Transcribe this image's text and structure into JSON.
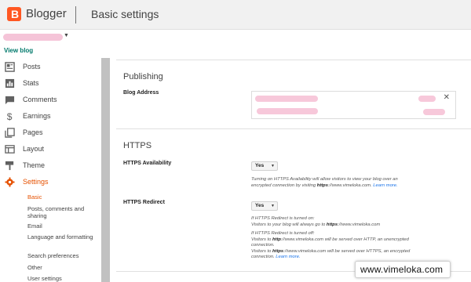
{
  "header": {
    "brand": "Blogger",
    "page_title": "Basic settings",
    "logo_letter": "B",
    "logo_color": "#ff5722"
  },
  "blog_picker": {
    "view_blog": "View blog"
  },
  "sidebar": {
    "items": [
      {
        "label": "Posts",
        "icon": "posts-icon"
      },
      {
        "label": "Stats",
        "icon": "stats-icon"
      },
      {
        "label": "Comments",
        "icon": "comments-icon"
      },
      {
        "label": "Earnings",
        "icon": "dollar-icon"
      },
      {
        "label": "Pages",
        "icon": "pages-icon"
      },
      {
        "label": "Layout",
        "icon": "layout-icon"
      },
      {
        "label": "Theme",
        "icon": "theme-icon"
      },
      {
        "label": "Settings",
        "icon": "gear-icon"
      }
    ],
    "settings_sub": [
      "Basic",
      "Posts, comments and sharing",
      "Email",
      "Language and formatting",
      "Search preferences",
      "Other",
      "User settings"
    ]
  },
  "main": {
    "publishing": {
      "title": "Publishing",
      "blog_address_label": "Blog Address"
    },
    "https": {
      "title": "HTTPS",
      "availability_label": "HTTPS Availability",
      "availability_value": "Yes",
      "availability_help_1": "Turning on HTTPS Availability will allow visitors to view your blog over an",
      "availability_help_2a": "encrypted connection by visiting ",
      "availability_help_2b": "https",
      "availability_help_2c": "://www.vimeloka.com. ",
      "learn_more": "Learn more.",
      "redirect_label": "HTTPS Redirect",
      "redirect_value": "Yes",
      "redirect_help_1": "If HTTPS Redirect is turned on:",
      "redirect_help_2a": "Visitors to your blog will always go to ",
      "redirect_help_2b": "https",
      "redirect_help_2c": "://www.vimeloka.com",
      "redirect_help_3": "If HTTPS Redirect is turned off:",
      "redirect_help_4a": "Visitors to ",
      "redirect_help_4b": "http",
      "redirect_help_4c": "://www.vimeloka.com will be served over HTTP, an unencrypted",
      "redirect_help_5": "connection.",
      "redirect_help_6a": "Visitors to ",
      "redirect_help_6b": "https",
      "redirect_help_6c": "://www.vimeloka.com will be served over HTTPS, an encrypted",
      "redirect_help_7": "connection."
    }
  },
  "watermark": "www.vimeloka.com"
}
